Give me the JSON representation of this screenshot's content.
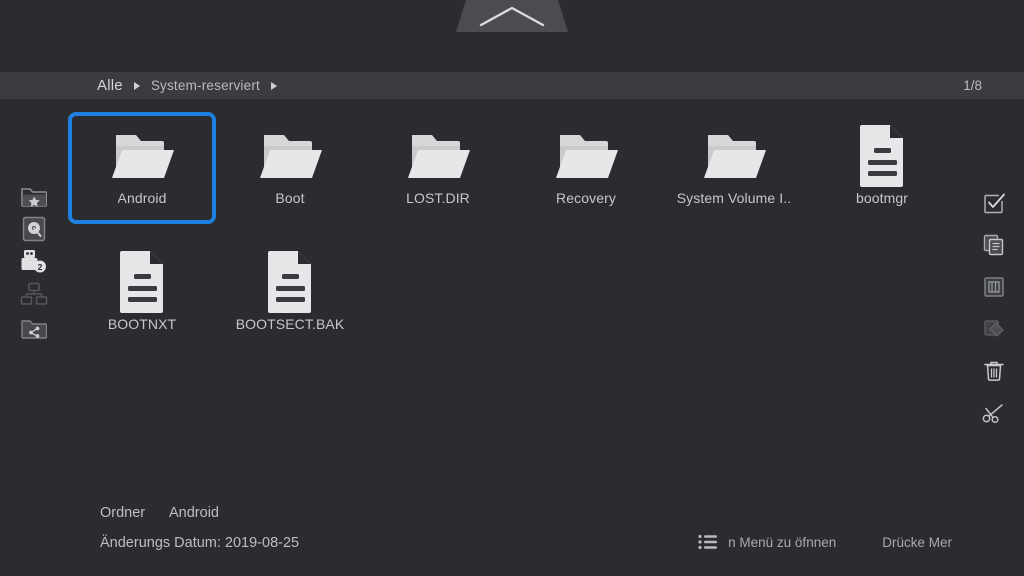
{
  "window": {
    "notch_icon": "chevron-up-icon"
  },
  "breadcrumb": {
    "root_label": "Alle",
    "current_label": "System-reserviert",
    "page_count": "1/8"
  },
  "items": [
    {
      "label": "Android",
      "type": "folder",
      "selected": true
    },
    {
      "label": "Boot",
      "type": "folder",
      "selected": false
    },
    {
      "label": "LOST.DIR",
      "type": "folder",
      "selected": false
    },
    {
      "label": "Recovery",
      "type": "folder",
      "selected": false
    },
    {
      "label": "System Volume I..",
      "type": "folder",
      "selected": false
    },
    {
      "label": "bootmgr",
      "type": "file",
      "selected": false
    },
    {
      "label": "BOOTNXT",
      "type": "file",
      "selected": false
    },
    {
      "label": "BOOTSECT.BAK",
      "type": "file",
      "selected": false
    }
  ],
  "left_rail": [
    {
      "name": "favorites-folder-icon"
    },
    {
      "name": "hard-drive-icon"
    },
    {
      "name": "usb-drive-icon",
      "badge": "2"
    },
    {
      "name": "network-icon"
    },
    {
      "name": "shared-folder-icon"
    }
  ],
  "right_rail": [
    {
      "name": "select-checkbox-icon"
    },
    {
      "name": "copy-icon"
    },
    {
      "name": "paste-icon"
    },
    {
      "name": "cut-paste-icon"
    },
    {
      "name": "trash-icon"
    },
    {
      "name": "scissors-icon"
    }
  ],
  "status": {
    "type_label": "Ordner",
    "name_value": "Android",
    "modified_label": "Änderungs Datum: 2019-08-25"
  },
  "hints": {
    "menu_icon": "list-menu-icon",
    "menu_text": "n Menü zu öfnnen",
    "press_text": "Drücke Mer"
  },
  "colors": {
    "background": "#2b2c30",
    "breadcrumb_bar": "#3a3c41",
    "notch": "#4a4c51",
    "selection": "#1f7fe0",
    "icon_light": "#e2e3e4",
    "text": "#c6c7c9",
    "text_dim": "#a9aaad"
  }
}
